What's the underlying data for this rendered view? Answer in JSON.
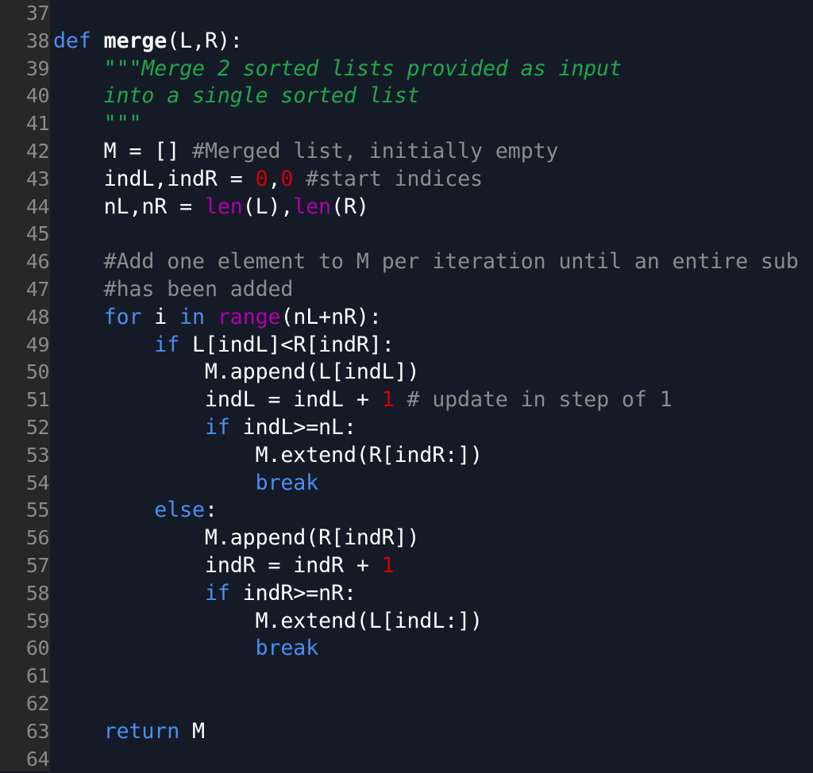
{
  "editor": {
    "language": "python",
    "colors": {
      "background": "#151a27",
      "gutter_background": "#272727",
      "line_number": "#8a8a8a",
      "keyword": "#4b8ef0",
      "docstring": "#1fa84a",
      "comment": "#8c8c8c",
      "number": "#d40000",
      "builtin": "#b000b0",
      "default": "#ffffff"
    },
    "lines": [
      {
        "number": "37",
        "tokens": []
      },
      {
        "number": "38",
        "tokens": [
          {
            "t": "kw",
            "v": "def"
          },
          {
            "t": "id",
            "v": " "
          },
          {
            "t": "fn",
            "v": "merge"
          },
          {
            "t": "id",
            "v": "(L,R):"
          }
        ]
      },
      {
        "number": "39",
        "tokens": [
          {
            "t": "id",
            "v": "    "
          },
          {
            "t": "doc",
            "v": "\"\"\"Merge 2 sorted lists provided as input"
          }
        ]
      },
      {
        "number": "40",
        "tokens": [
          {
            "t": "id",
            "v": "    "
          },
          {
            "t": "doc",
            "v": "into a single sorted list"
          }
        ]
      },
      {
        "number": "41",
        "tokens": [
          {
            "t": "id",
            "v": "    "
          },
          {
            "t": "doc",
            "v": "\"\"\""
          }
        ]
      },
      {
        "number": "42",
        "tokens": [
          {
            "t": "id",
            "v": "    M = [] "
          },
          {
            "t": "cm",
            "v": "#Merged list, initially empty"
          }
        ]
      },
      {
        "number": "43",
        "tokens": [
          {
            "t": "id",
            "v": "    indL,indR = "
          },
          {
            "t": "num",
            "v": "0"
          },
          {
            "t": "id",
            "v": ","
          },
          {
            "t": "num",
            "v": "0"
          },
          {
            "t": "id",
            "v": " "
          },
          {
            "t": "cm",
            "v": "#start indices"
          }
        ]
      },
      {
        "number": "44",
        "tokens": [
          {
            "t": "id",
            "v": "    nL,nR = "
          },
          {
            "t": "bi",
            "v": "len"
          },
          {
            "t": "id",
            "v": "(L),"
          },
          {
            "t": "bi",
            "v": "len"
          },
          {
            "t": "id",
            "v": "(R)"
          }
        ]
      },
      {
        "number": "45",
        "tokens": []
      },
      {
        "number": "46",
        "tokens": [
          {
            "t": "id",
            "v": "    "
          },
          {
            "t": "cm",
            "v": "#Add one element to M per iteration until an entire sub"
          }
        ]
      },
      {
        "number": "47",
        "tokens": [
          {
            "t": "id",
            "v": "    "
          },
          {
            "t": "cm",
            "v": "#has been added"
          }
        ]
      },
      {
        "number": "48",
        "tokens": [
          {
            "t": "id",
            "v": "    "
          },
          {
            "t": "kw",
            "v": "for"
          },
          {
            "t": "id",
            "v": " i "
          },
          {
            "t": "kw",
            "v": "in"
          },
          {
            "t": "id",
            "v": " "
          },
          {
            "t": "bi",
            "v": "range"
          },
          {
            "t": "id",
            "v": "(nL+nR):"
          }
        ]
      },
      {
        "number": "49",
        "tokens": [
          {
            "t": "id",
            "v": "        "
          },
          {
            "t": "kw",
            "v": "if"
          },
          {
            "t": "id",
            "v": " L[indL]<R[indR]:"
          }
        ]
      },
      {
        "number": "50",
        "tokens": [
          {
            "t": "id",
            "v": "            M.append(L[indL])"
          }
        ]
      },
      {
        "number": "51",
        "tokens": [
          {
            "t": "id",
            "v": "            indL = indL + "
          },
          {
            "t": "num",
            "v": "1"
          },
          {
            "t": "id",
            "v": " "
          },
          {
            "t": "cm",
            "v": "# update in step of 1"
          }
        ]
      },
      {
        "number": "52",
        "tokens": [
          {
            "t": "id",
            "v": "            "
          },
          {
            "t": "kw",
            "v": "if"
          },
          {
            "t": "id",
            "v": " indL>=nL:"
          }
        ]
      },
      {
        "number": "53",
        "tokens": [
          {
            "t": "id",
            "v": "                M.extend(R[indR:])"
          }
        ]
      },
      {
        "number": "54",
        "tokens": [
          {
            "t": "id",
            "v": "                "
          },
          {
            "t": "kw",
            "v": "break"
          }
        ]
      },
      {
        "number": "55",
        "tokens": [
          {
            "t": "id",
            "v": "        "
          },
          {
            "t": "kw",
            "v": "else"
          },
          {
            "t": "id",
            "v": ":"
          }
        ]
      },
      {
        "number": "56",
        "tokens": [
          {
            "t": "id",
            "v": "            M.append(R[indR])"
          }
        ]
      },
      {
        "number": "57",
        "tokens": [
          {
            "t": "id",
            "v": "            indR = indR + "
          },
          {
            "t": "num",
            "v": "1"
          }
        ]
      },
      {
        "number": "58",
        "tokens": [
          {
            "t": "id",
            "v": "            "
          },
          {
            "t": "kw",
            "v": "if"
          },
          {
            "t": "id",
            "v": " indR>=nR:"
          }
        ]
      },
      {
        "number": "59",
        "tokens": [
          {
            "t": "id",
            "v": "                M.extend(L[indL:])"
          }
        ]
      },
      {
        "number": "60",
        "tokens": [
          {
            "t": "id",
            "v": "                "
          },
          {
            "t": "kw",
            "v": "break"
          }
        ]
      },
      {
        "number": "61",
        "tokens": []
      },
      {
        "number": "62",
        "tokens": []
      },
      {
        "number": "63",
        "tokens": [
          {
            "t": "id",
            "v": "    "
          },
          {
            "t": "kw",
            "v": "return"
          },
          {
            "t": "id",
            "v": " M"
          }
        ]
      },
      {
        "number": "64",
        "tokens": []
      }
    ]
  }
}
